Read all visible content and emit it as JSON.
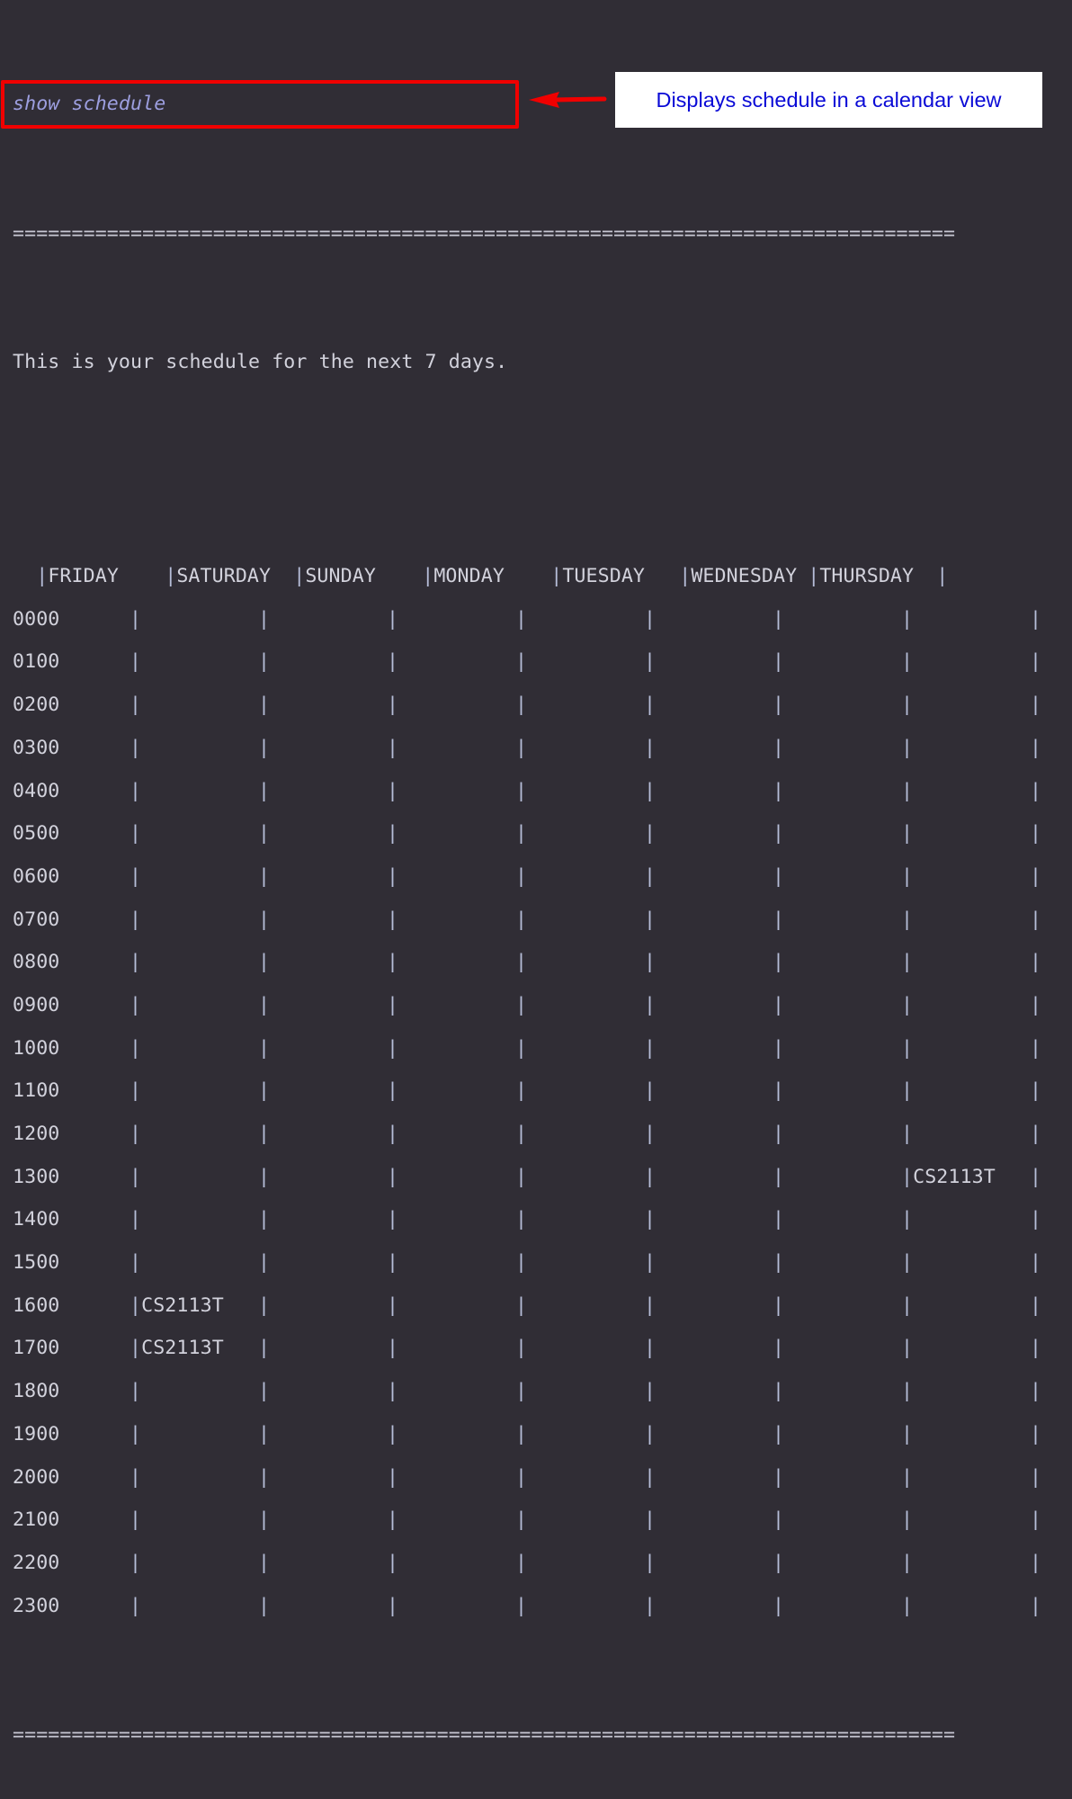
{
  "terminal": {
    "command": "show schedule",
    "separator": "================================================================================",
    "message": "This is your schedule for the next 7 days.",
    "pipe_char": "|",
    "days": [
      "FRIDAY",
      "SATURDAY",
      "SUNDAY",
      "MONDAY",
      "TUESDAY",
      "WEDNESDAY",
      "THURSDAY"
    ],
    "rows": [
      {
        "time": "0000",
        "cells": [
          "",
          "",
          "",
          "",
          "",
          "",
          ""
        ]
      },
      {
        "time": "0100",
        "cells": [
          "",
          "",
          "",
          "",
          "",
          "",
          ""
        ]
      },
      {
        "time": "0200",
        "cells": [
          "",
          "",
          "",
          "",
          "",
          "",
          ""
        ]
      },
      {
        "time": "0300",
        "cells": [
          "",
          "",
          "",
          "",
          "",
          "",
          ""
        ]
      },
      {
        "time": "0400",
        "cells": [
          "",
          "",
          "",
          "",
          "",
          "",
          ""
        ]
      },
      {
        "time": "0500",
        "cells": [
          "",
          "",
          "",
          "",
          "",
          "",
          ""
        ]
      },
      {
        "time": "0600",
        "cells": [
          "",
          "",
          "",
          "",
          "",
          "",
          ""
        ]
      },
      {
        "time": "0700",
        "cells": [
          "",
          "",
          "",
          "",
          "",
          "",
          ""
        ]
      },
      {
        "time": "0800",
        "cells": [
          "",
          "",
          "",
          "",
          "",
          "",
          ""
        ]
      },
      {
        "time": "0900",
        "cells": [
          "",
          "",
          "",
          "",
          "",
          "",
          ""
        ]
      },
      {
        "time": "1000",
        "cells": [
          "",
          "",
          "",
          "",
          "",
          "",
          ""
        ]
      },
      {
        "time": "1100",
        "cells": [
          "",
          "",
          "",
          "",
          "",
          "",
          ""
        ]
      },
      {
        "time": "1200",
        "cells": [
          "",
          "",
          "",
          "",
          "",
          "",
          ""
        ]
      },
      {
        "time": "1300",
        "cells": [
          "",
          "",
          "",
          "",
          "",
          "",
          "CS2113T"
        ]
      },
      {
        "time": "1400",
        "cells": [
          "",
          "",
          "",
          "",
          "",
          "",
          ""
        ]
      },
      {
        "time": "1500",
        "cells": [
          "",
          "",
          "",
          "",
          "",
          "",
          ""
        ]
      },
      {
        "time": "1600",
        "cells": [
          "CS2113T",
          "",
          "",
          "",
          "",
          "",
          ""
        ]
      },
      {
        "time": "1700",
        "cells": [
          "CS2113T",
          "",
          "",
          "",
          "",
          "",
          ""
        ]
      },
      {
        "time": "1800",
        "cells": [
          "",
          "",
          "",
          "",
          "",
          "",
          ""
        ]
      },
      {
        "time": "1900",
        "cells": [
          "",
          "",
          "",
          "",
          "",
          "",
          ""
        ]
      },
      {
        "time": "2000",
        "cells": [
          "",
          "",
          "",
          "",
          "",
          "",
          ""
        ]
      },
      {
        "time": "2100",
        "cells": [
          "",
          "",
          "",
          "",
          "",
          "",
          ""
        ]
      },
      {
        "time": "2200",
        "cells": [
          "",
          "",
          "",
          "",
          "",
          "",
          ""
        ]
      },
      {
        "time": "2300",
        "cells": [
          "",
          "",
          "",
          "",
          "",
          "",
          ""
        ]
      }
    ]
  },
  "annotation": {
    "callout_text": "Displays schedule in a calendar view",
    "highlight_color": "#f00000",
    "callout_text_color": "#0a0ad6"
  }
}
